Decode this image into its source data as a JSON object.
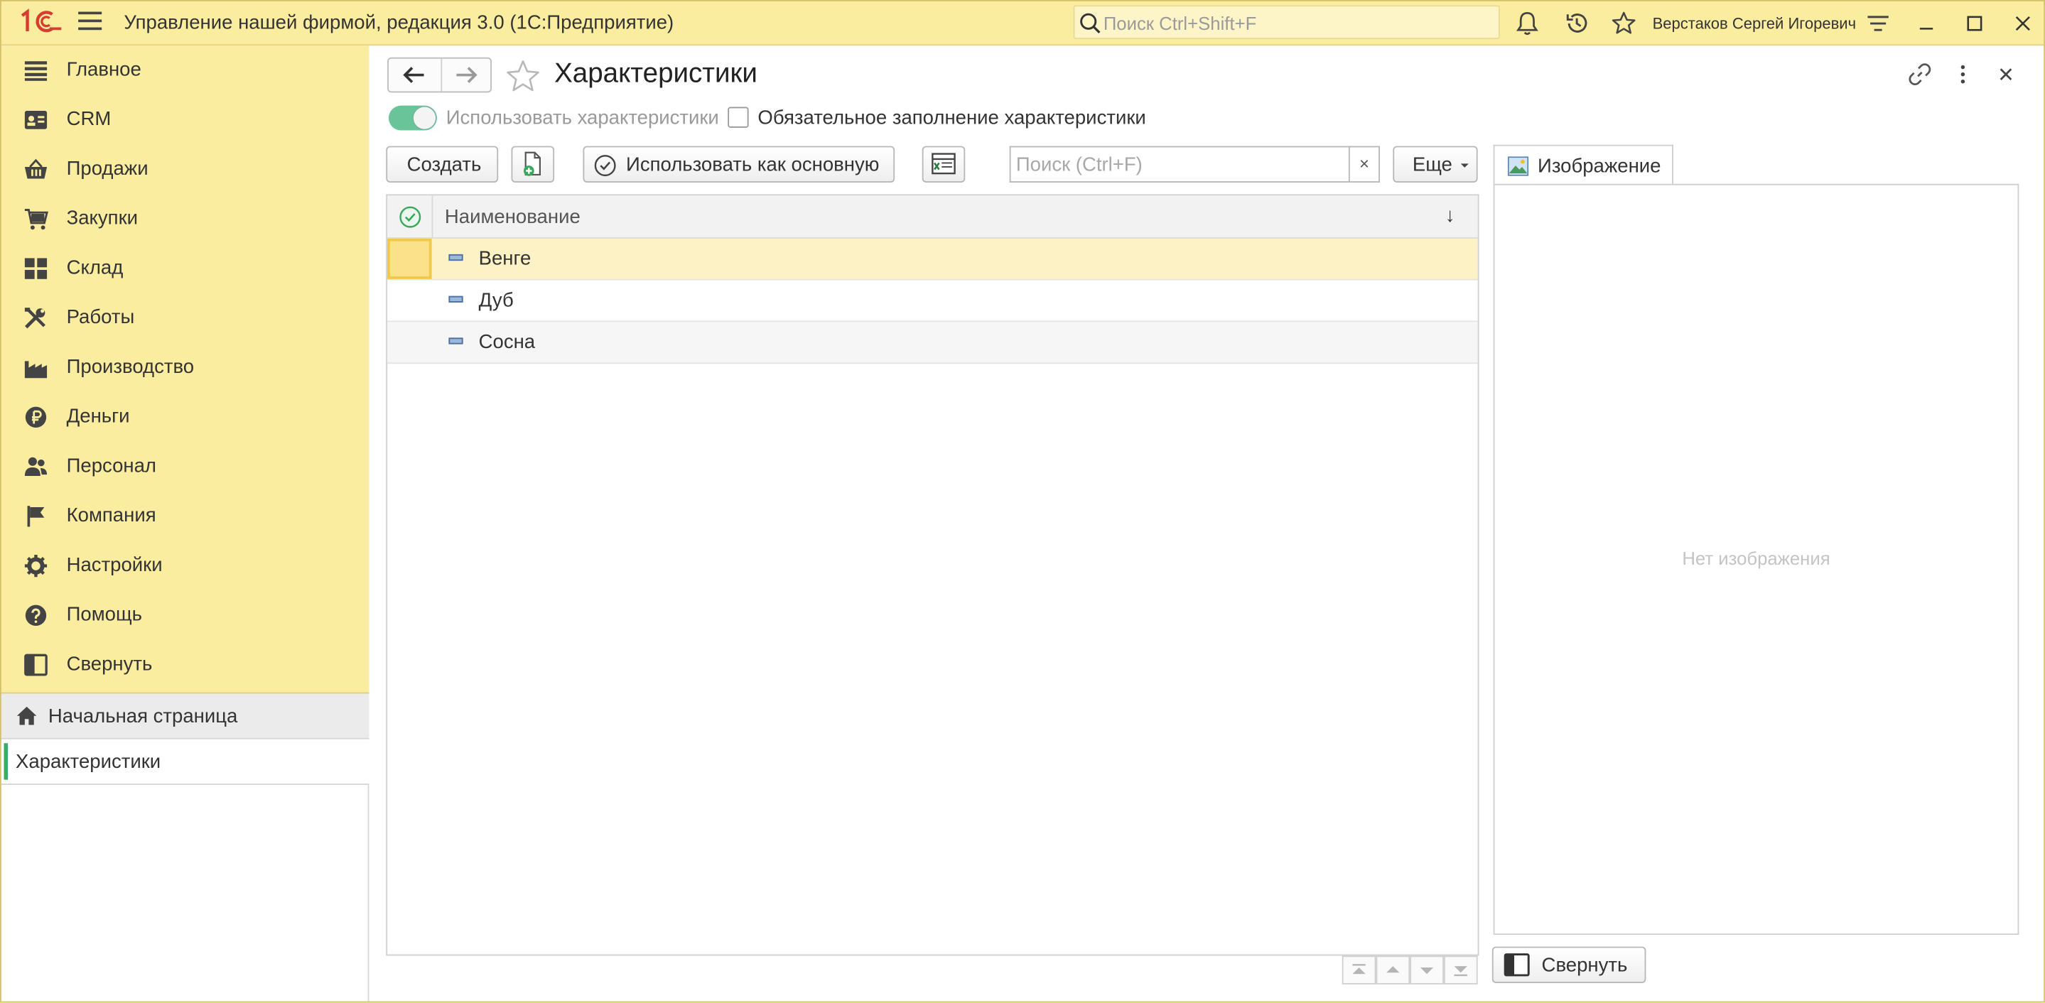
{
  "titlebar": {
    "app_title": "Управление нашей фирмой, редакция 3.0  (1С:Предприятие)",
    "search_placeholder": "Поиск Ctrl+Shift+F",
    "user_name": "Верстаков Сергей Игоревич"
  },
  "sidebar": {
    "sections": [
      {
        "label": "Главное",
        "icon": "main-menu-icon"
      },
      {
        "label": "CRM",
        "icon": "crm-icon"
      },
      {
        "label": "Продажи",
        "icon": "basket-icon"
      },
      {
        "label": "Закупки",
        "icon": "cart-icon"
      },
      {
        "label": "Склад",
        "icon": "warehouse-icon"
      },
      {
        "label": "Работы",
        "icon": "tools-icon"
      },
      {
        "label": "Производство",
        "icon": "factory-icon"
      },
      {
        "label": "Деньги",
        "icon": "ruble-icon"
      },
      {
        "label": "Персонал",
        "icon": "people-icon"
      },
      {
        "label": "Компания",
        "icon": "flag-icon"
      },
      {
        "label": "Настройки",
        "icon": "gear-icon"
      },
      {
        "label": "Помощь",
        "icon": "help-icon"
      },
      {
        "label": "Свернуть",
        "icon": "collapse-panel-icon"
      }
    ],
    "open_windows": {
      "home": "Начальная страница",
      "current": "Характеристики"
    }
  },
  "page": {
    "title": "Характеристики",
    "use_toggle_label": "Использовать характеристики",
    "use_toggle_on": true,
    "required_checkbox_label": "Обязательное заполнение характеристики",
    "required_checked": false
  },
  "toolbar": {
    "create_label": "Создать",
    "use_as_main_label": "Использовать как основную",
    "search_placeholder": "Поиск (Ctrl+F)",
    "clear_label": "×",
    "more_label": "Еще"
  },
  "table": {
    "column_name": "Наименование",
    "sort_indicator": "↓",
    "rows": [
      {
        "name": "Венге",
        "selected": true
      },
      {
        "name": "Дуб",
        "selected": false
      },
      {
        "name": "Сосна",
        "selected": false
      }
    ]
  },
  "image_panel": {
    "tab_label": "Изображение",
    "empty_text": "Нет изображения",
    "collapse_label": "Свернуть"
  },
  "colors": {
    "accent_yellow": "#fbeda0",
    "selected_row": "#fdf2c5",
    "toggle_green": "#69c49a",
    "logo_red": "#d63c2f"
  }
}
